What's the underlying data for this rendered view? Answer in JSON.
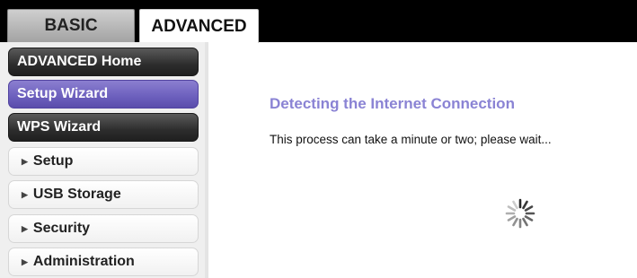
{
  "tabs": {
    "basic_label": "BASIC",
    "advanced_label": "ADVANCED"
  },
  "sidebar": {
    "items": [
      {
        "label": "ADVANCED Home",
        "style": "dark"
      },
      {
        "label": "Setup Wizard",
        "style": "selected"
      },
      {
        "label": "WPS Wizard",
        "style": "dark"
      },
      {
        "label": "Setup",
        "style": "collapsible"
      },
      {
        "label": "USB Storage",
        "style": "collapsible"
      },
      {
        "label": "Security",
        "style": "collapsible"
      },
      {
        "label": "Administration",
        "style": "collapsible"
      }
    ]
  },
  "main": {
    "title": "Detecting the Internet Connection",
    "message": "This process can take a minute or two; please wait..."
  },
  "icons": {
    "menu_arrow": "triangle-right-icon",
    "loading": "loading-spinner-icon"
  },
  "colors": {
    "selected_menu": "#6c5fbd",
    "title_text": "#8a83d4",
    "top_bar": "#000000"
  }
}
